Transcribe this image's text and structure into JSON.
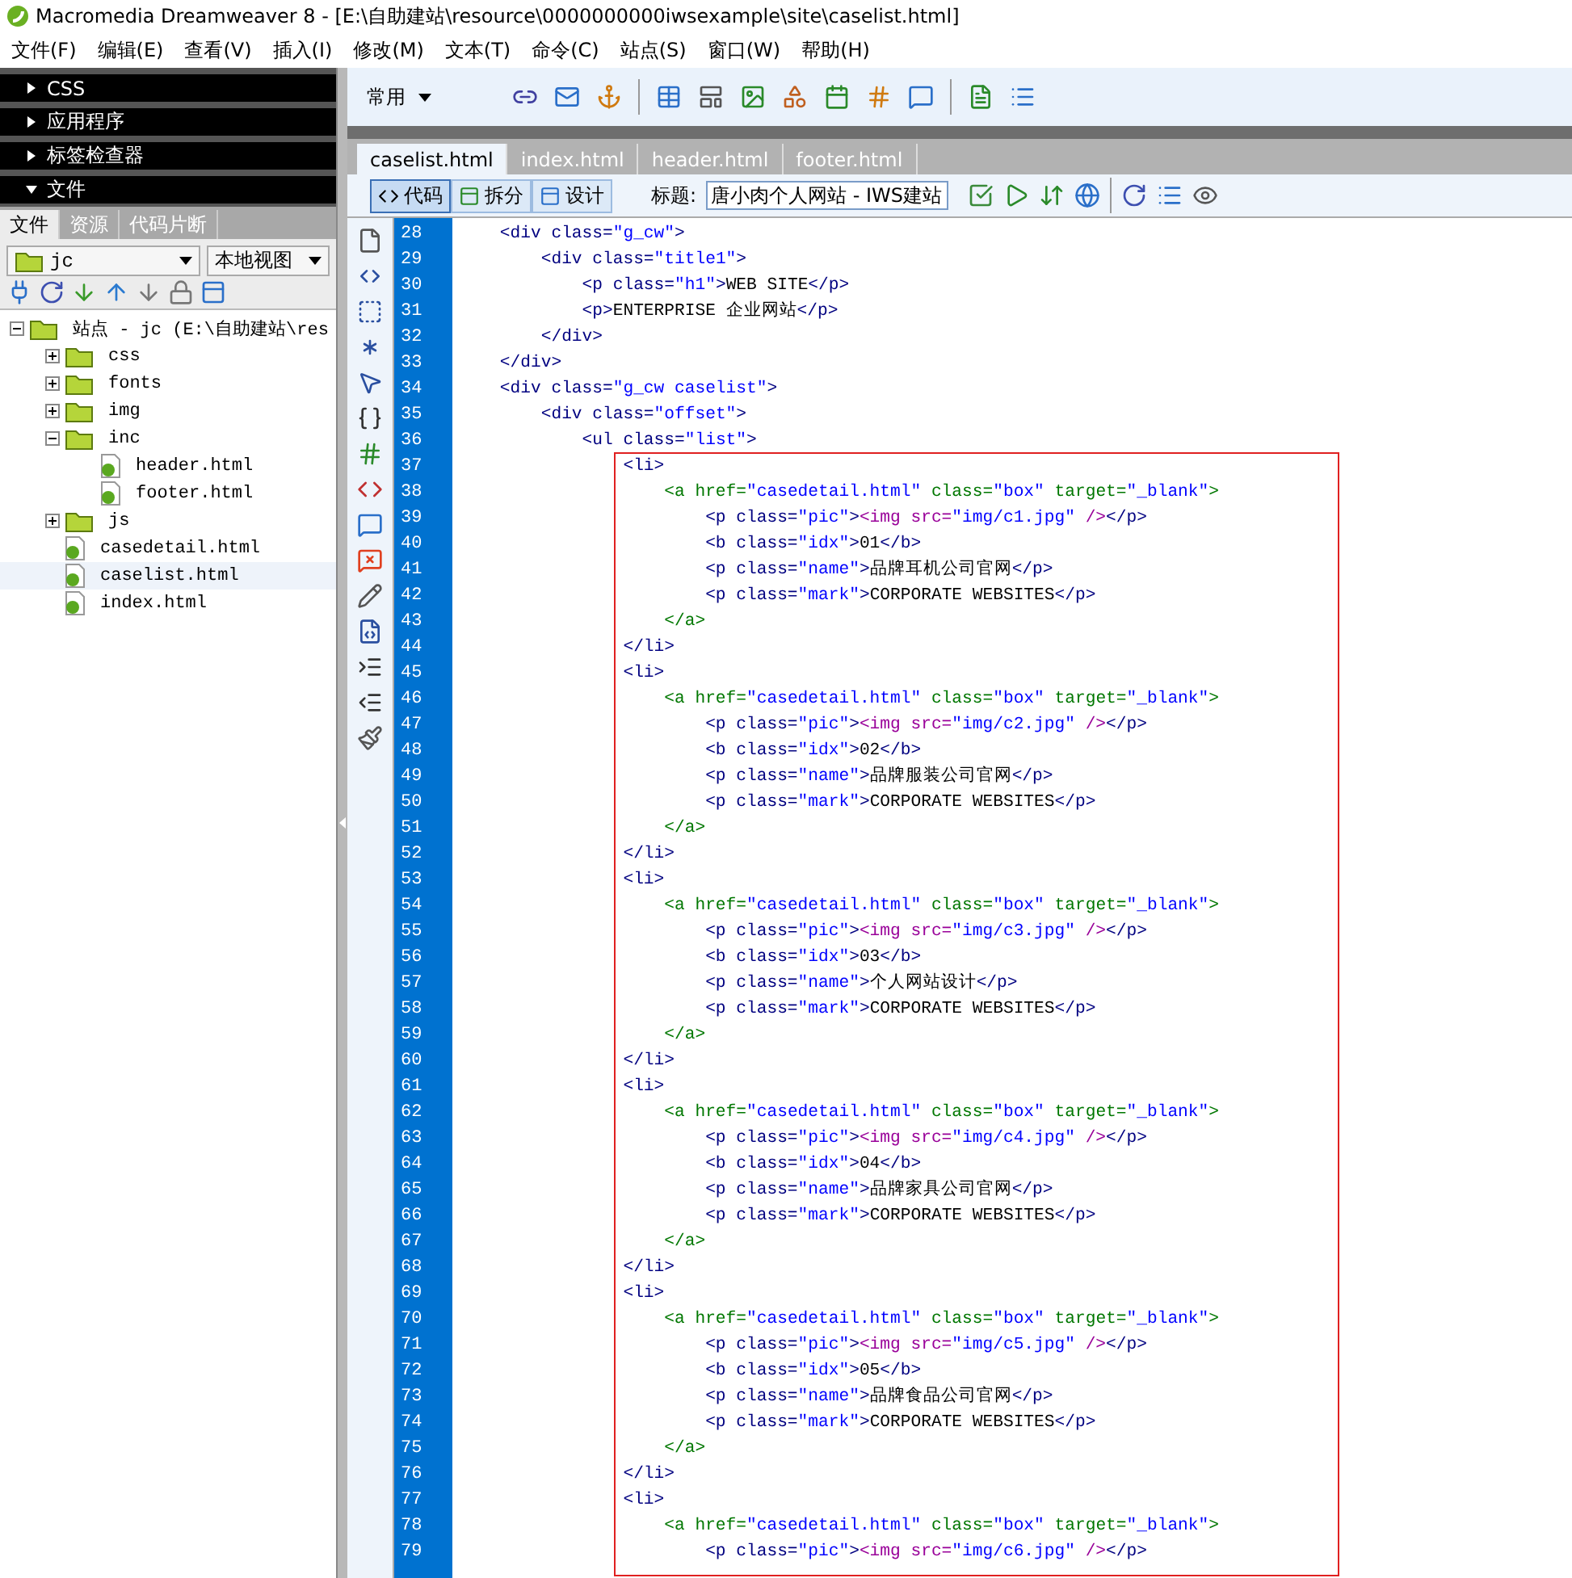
{
  "window": {
    "title": "Macromedia Dreamweaver 8 - [E:\\自助建站\\resource\\0000000000iwsexample\\site\\caselist.html]"
  },
  "menu": [
    "文件(F)",
    "编辑(E)",
    "查看(V)",
    "插入(I)",
    "修改(M)",
    "文本(T)",
    "命令(C)",
    "站点(S)",
    "窗口(W)",
    "帮助(H)"
  ],
  "panels": [
    {
      "title": "CSS",
      "expanded": false
    },
    {
      "title": "应用程序",
      "expanded": false
    },
    {
      "title": "标签检查器",
      "expanded": false
    },
    {
      "title": "文件",
      "expanded": true
    }
  ],
  "files_panel": {
    "tabs": [
      {
        "label": "文件",
        "selected": true
      },
      {
        "label": "资源",
        "selected": false
      },
      {
        "label": "代码片断",
        "selected": false
      }
    ],
    "site": "jc",
    "view": "本地视图",
    "tree": [
      {
        "label": "站点 - jc (E:\\自助建站\\res",
        "kind": "folder",
        "expanded": true,
        "selected": false,
        "children": [
          {
            "label": "css",
            "kind": "folder",
            "expanded": false,
            "selected": false
          },
          {
            "label": "fonts",
            "kind": "folder",
            "expanded": false,
            "selected": false
          },
          {
            "label": "img",
            "kind": "folder",
            "expanded": false,
            "selected": false
          },
          {
            "label": "inc",
            "kind": "folder",
            "expanded": true,
            "selected": false,
            "children": [
              {
                "label": "header.html",
                "kind": "file",
                "selected": false
              },
              {
                "label": "footer.html",
                "kind": "file",
                "selected": false
              }
            ]
          },
          {
            "label": "js",
            "kind": "folder",
            "expanded": false,
            "selected": false
          },
          {
            "label": "casedetail.html",
            "kind": "file",
            "selected": false
          },
          {
            "label": "caselist.html",
            "kind": "file",
            "selected": true
          },
          {
            "label": "index.html",
            "kind": "file",
            "selected": false
          }
        ]
      }
    ]
  },
  "insert_bar": {
    "category": "常用"
  },
  "document_tabs": [
    {
      "label": "caselist.html",
      "selected": true
    },
    {
      "label": "index.html",
      "selected": false
    },
    {
      "label": "header.html",
      "selected": false
    },
    {
      "label": "footer.html",
      "selected": false
    }
  ],
  "document_toolbar": {
    "view_buttons": [
      {
        "label": "代码",
        "selected": true
      },
      {
        "label": "拆分",
        "selected": false
      },
      {
        "label": "设计",
        "selected": false
      }
    ],
    "title_label": "标题:",
    "title_value": "唐小肉个人网站 - IWS建站"
  },
  "editor": {
    "lines": [
      {
        "number": "28",
        "segments": [
          {
            "kind": "tag",
            "text": "    <div class="
          },
          {
            "kind": "value",
            "text": "\"g_cw\""
          },
          {
            "kind": "tag",
            "text": ">"
          }
        ]
      },
      {
        "number": "29",
        "segments": [
          {
            "kind": "tag",
            "text": "        <div class="
          },
          {
            "kind": "value",
            "text": "\"title1\""
          },
          {
            "kind": "tag",
            "text": ">"
          }
        ]
      },
      {
        "number": "30",
        "segments": [
          {
            "kind": "tag",
            "text": "            <p class="
          },
          {
            "kind": "value",
            "text": "\"h1\""
          },
          {
            "kind": "tag",
            "text": ">"
          },
          {
            "kind": "text",
            "text": "WEB SITE"
          },
          {
            "kind": "tag",
            "text": "</p>"
          }
        ]
      },
      {
        "number": "31",
        "segments": [
          {
            "kind": "tag",
            "text": "            <p>"
          },
          {
            "kind": "text",
            "text": "ENTERPRISE 企业网站"
          },
          {
            "kind": "tag",
            "text": "</p>"
          }
        ]
      },
      {
        "number": "32",
        "segments": [
          {
            "kind": "tag",
            "text": "        </div>"
          }
        ]
      },
      {
        "number": "33",
        "segments": [
          {
            "kind": "tag",
            "text": "    </div>"
          }
        ]
      },
      {
        "number": "34",
        "segments": [
          {
            "kind": "tag",
            "text": "    <div class="
          },
          {
            "kind": "value",
            "text": "\"g_cw caselist\""
          },
          {
            "kind": "tag",
            "text": ">"
          }
        ]
      },
      {
        "number": "35",
        "segments": [
          {
            "kind": "tag",
            "text": "        <div class="
          },
          {
            "kind": "value",
            "text": "\"offset\""
          },
          {
            "kind": "tag",
            "text": ">"
          }
        ]
      },
      {
        "number": "36",
        "segments": [
          {
            "kind": "tag",
            "text": "            <ul class="
          },
          {
            "kind": "value",
            "text": "\"list\""
          },
          {
            "kind": "tag",
            "text": ">"
          }
        ]
      }
    ],
    "boxed_lines": [
      {
        "number": "37",
        "segments": [
          {
            "kind": "tag",
            "text": "                <li>"
          }
        ]
      },
      {
        "number": "38",
        "segments": [
          {
            "kind": "anchor",
            "text": "                    <a href="
          },
          {
            "kind": "value",
            "text": "\"casedetail.html\""
          },
          {
            "kind": "anchor",
            "text": " class="
          },
          {
            "kind": "value",
            "text": "\"box\""
          },
          {
            "kind": "anchor",
            "text": " target="
          },
          {
            "kind": "value",
            "text": "\"_blank\""
          },
          {
            "kind": "anchor",
            "text": ">"
          }
        ]
      },
      {
        "number": "39",
        "segments": [
          {
            "kind": "tag",
            "text": "                        <p class="
          },
          {
            "kind": "value",
            "text": "\"pic\""
          },
          {
            "kind": "tag",
            "text": ">"
          },
          {
            "kind": "image",
            "text": "<img src="
          },
          {
            "kind": "value",
            "text": "\"img/c1.jpg\""
          },
          {
            "kind": "image",
            "text": " />"
          },
          {
            "kind": "tag",
            "text": "</p>"
          }
        ]
      },
      {
        "number": "40",
        "segments": [
          {
            "kind": "tag",
            "text": "                        <b class="
          },
          {
            "kind": "value",
            "text": "\"idx\""
          },
          {
            "kind": "tag",
            "text": ">"
          },
          {
            "kind": "text",
            "text": "01"
          },
          {
            "kind": "tag",
            "text": "</b>"
          }
        ]
      },
      {
        "number": "41",
        "segments": [
          {
            "kind": "tag",
            "text": "                        <p class="
          },
          {
            "kind": "value",
            "text": "\"name\""
          },
          {
            "kind": "tag",
            "text": ">"
          },
          {
            "kind": "text",
            "text": "品牌耳机公司官网"
          },
          {
            "kind": "tag",
            "text": "</p>"
          }
        ]
      },
      {
        "number": "42",
        "segments": [
          {
            "kind": "tag",
            "text": "                        <p class="
          },
          {
            "kind": "value",
            "text": "\"mark\""
          },
          {
            "kind": "tag",
            "text": ">"
          },
          {
            "kind": "text",
            "text": "CORPORATE WEBSITES"
          },
          {
            "kind": "tag",
            "text": "</p>"
          }
        ]
      },
      {
        "number": "43",
        "segments": [
          {
            "kind": "anchor",
            "text": "                    </a>"
          }
        ]
      },
      {
        "number": "44",
        "segments": [
          {
            "kind": "tag",
            "text": "                </li>"
          }
        ]
      },
      {
        "number": "45",
        "segments": [
          {
            "kind": "tag",
            "text": "                <li>"
          }
        ]
      },
      {
        "number": "46",
        "segments": [
          {
            "kind": "anchor",
            "text": "                    <a href="
          },
          {
            "kind": "value",
            "text": "\"casedetail.html\""
          },
          {
            "kind": "anchor",
            "text": " class="
          },
          {
            "kind": "value",
            "text": "\"box\""
          },
          {
            "kind": "anchor",
            "text": " target="
          },
          {
            "kind": "value",
            "text": "\"_blank\""
          },
          {
            "kind": "anchor",
            "text": ">"
          }
        ]
      },
      {
        "number": "47",
        "segments": [
          {
            "kind": "tag",
            "text": "                        <p class="
          },
          {
            "kind": "value",
            "text": "\"pic\""
          },
          {
            "kind": "tag",
            "text": ">"
          },
          {
            "kind": "image",
            "text": "<img src="
          },
          {
            "kind": "value",
            "text": "\"img/c2.jpg\""
          },
          {
            "kind": "image",
            "text": " />"
          },
          {
            "kind": "tag",
            "text": "</p>"
          }
        ]
      },
      {
        "number": "48",
        "segments": [
          {
            "kind": "tag",
            "text": "                        <b class="
          },
          {
            "kind": "value",
            "text": "\"idx\""
          },
          {
            "kind": "tag",
            "text": ">"
          },
          {
            "kind": "text",
            "text": "02"
          },
          {
            "kind": "tag",
            "text": "</b>"
          }
        ]
      },
      {
        "number": "49",
        "segments": [
          {
            "kind": "tag",
            "text": "                        <p class="
          },
          {
            "kind": "value",
            "text": "\"name\""
          },
          {
            "kind": "tag",
            "text": ">"
          },
          {
            "kind": "text",
            "text": "品牌服装公司官网"
          },
          {
            "kind": "tag",
            "text": "</p>"
          }
        ]
      },
      {
        "number": "50",
        "segments": [
          {
            "kind": "tag",
            "text": "                        <p class="
          },
          {
            "kind": "value",
            "text": "\"mark\""
          },
          {
            "kind": "tag",
            "text": ">"
          },
          {
            "kind": "text",
            "text": "CORPORATE WEBSITES"
          },
          {
            "kind": "tag",
            "text": "</p>"
          }
        ]
      },
      {
        "number": "51",
        "segments": [
          {
            "kind": "anchor",
            "text": "                    </a>"
          }
        ]
      },
      {
        "number": "52",
        "segments": [
          {
            "kind": "tag",
            "text": "                </li>"
          }
        ]
      },
      {
        "number": "53",
        "segments": [
          {
            "kind": "tag",
            "text": "                <li>"
          }
        ]
      },
      {
        "number": "54",
        "segments": [
          {
            "kind": "anchor",
            "text": "                    <a href="
          },
          {
            "kind": "value",
            "text": "\"casedetail.html\""
          },
          {
            "kind": "anchor",
            "text": " class="
          },
          {
            "kind": "value",
            "text": "\"box\""
          },
          {
            "kind": "anchor",
            "text": " target="
          },
          {
            "kind": "value",
            "text": "\"_blank\""
          },
          {
            "kind": "anchor",
            "text": ">"
          }
        ]
      },
      {
        "number": "55",
        "segments": [
          {
            "kind": "tag",
            "text": "                        <p class="
          },
          {
            "kind": "value",
            "text": "\"pic\""
          },
          {
            "kind": "tag",
            "text": ">"
          },
          {
            "kind": "image",
            "text": "<img src="
          },
          {
            "kind": "value",
            "text": "\"img/c3.jpg\""
          },
          {
            "kind": "image",
            "text": " />"
          },
          {
            "kind": "tag",
            "text": "</p>"
          }
        ]
      },
      {
        "number": "56",
        "segments": [
          {
            "kind": "tag",
            "text": "                        <b class="
          },
          {
            "kind": "value",
            "text": "\"idx\""
          },
          {
            "kind": "tag",
            "text": ">"
          },
          {
            "kind": "text",
            "text": "03"
          },
          {
            "kind": "tag",
            "text": "</b>"
          }
        ]
      },
      {
        "number": "57",
        "segments": [
          {
            "kind": "tag",
            "text": "                        <p class="
          },
          {
            "kind": "value",
            "text": "\"name\""
          },
          {
            "kind": "tag",
            "text": ">"
          },
          {
            "kind": "text",
            "text": "个人网站设计"
          },
          {
            "kind": "tag",
            "text": "</p>"
          }
        ]
      },
      {
        "number": "58",
        "segments": [
          {
            "kind": "tag",
            "text": "                        <p class="
          },
          {
            "kind": "value",
            "text": "\"mark\""
          },
          {
            "kind": "tag",
            "text": ">"
          },
          {
            "kind": "text",
            "text": "CORPORATE WEBSITES"
          },
          {
            "kind": "tag",
            "text": "</p>"
          }
        ]
      },
      {
        "number": "59",
        "segments": [
          {
            "kind": "anchor",
            "text": "                    </a>"
          }
        ]
      },
      {
        "number": "60",
        "segments": [
          {
            "kind": "tag",
            "text": "                </li>"
          }
        ]
      },
      {
        "number": "61",
        "segments": [
          {
            "kind": "tag",
            "text": "                <li>"
          }
        ]
      },
      {
        "number": "62",
        "segments": [
          {
            "kind": "anchor",
            "text": "                    <a href="
          },
          {
            "kind": "value",
            "text": "\"casedetail.html\""
          },
          {
            "kind": "anchor",
            "text": " class="
          },
          {
            "kind": "value",
            "text": "\"box\""
          },
          {
            "kind": "anchor",
            "text": " target="
          },
          {
            "kind": "value",
            "text": "\"_blank\""
          },
          {
            "kind": "anchor",
            "text": ">"
          }
        ]
      },
      {
        "number": "63",
        "segments": [
          {
            "kind": "tag",
            "text": "                        <p class="
          },
          {
            "kind": "value",
            "text": "\"pic\""
          },
          {
            "kind": "tag",
            "text": ">"
          },
          {
            "kind": "image",
            "text": "<img src="
          },
          {
            "kind": "value",
            "text": "\"img/c4.jpg\""
          },
          {
            "kind": "image",
            "text": " />"
          },
          {
            "kind": "tag",
            "text": "</p>"
          }
        ]
      },
      {
        "number": "64",
        "segments": [
          {
            "kind": "tag",
            "text": "                        <b class="
          },
          {
            "kind": "value",
            "text": "\"idx\""
          },
          {
            "kind": "tag",
            "text": ">"
          },
          {
            "kind": "text",
            "text": "04"
          },
          {
            "kind": "tag",
            "text": "</b>"
          }
        ]
      },
      {
        "number": "65",
        "segments": [
          {
            "kind": "tag",
            "text": "                        <p class="
          },
          {
            "kind": "value",
            "text": "\"name\""
          },
          {
            "kind": "tag",
            "text": ">"
          },
          {
            "kind": "text",
            "text": "品牌家具公司官网"
          },
          {
            "kind": "tag",
            "text": "</p>"
          }
        ]
      },
      {
        "number": "66",
        "segments": [
          {
            "kind": "tag",
            "text": "                        <p class="
          },
          {
            "kind": "value",
            "text": "\"mark\""
          },
          {
            "kind": "tag",
            "text": ">"
          },
          {
            "kind": "text",
            "text": "CORPORATE WEBSITES"
          },
          {
            "kind": "tag",
            "text": "</p>"
          }
        ]
      },
      {
        "number": "67",
        "segments": [
          {
            "kind": "anchor",
            "text": "                    </a>"
          }
        ]
      },
      {
        "number": "68",
        "segments": [
          {
            "kind": "tag",
            "text": "                </li>"
          }
        ]
      },
      {
        "number": "69",
        "segments": [
          {
            "kind": "tag",
            "text": "                <li>"
          }
        ]
      },
      {
        "number": "70",
        "segments": [
          {
            "kind": "anchor",
            "text": "                    <a href="
          },
          {
            "kind": "value",
            "text": "\"casedetail.html\""
          },
          {
            "kind": "anchor",
            "text": " class="
          },
          {
            "kind": "value",
            "text": "\"box\""
          },
          {
            "kind": "anchor",
            "text": " target="
          },
          {
            "kind": "value",
            "text": "\"_blank\""
          },
          {
            "kind": "anchor",
            "text": ">"
          }
        ]
      },
      {
        "number": "71",
        "segments": [
          {
            "kind": "tag",
            "text": "                        <p class="
          },
          {
            "kind": "value",
            "text": "\"pic\""
          },
          {
            "kind": "tag",
            "text": ">"
          },
          {
            "kind": "image",
            "text": "<img src="
          },
          {
            "kind": "value",
            "text": "\"img/c5.jpg\""
          },
          {
            "kind": "image",
            "text": " />"
          },
          {
            "kind": "tag",
            "text": "</p>"
          }
        ]
      },
      {
        "number": "72",
        "segments": [
          {
            "kind": "tag",
            "text": "                        <b class="
          },
          {
            "kind": "value",
            "text": "\"idx\""
          },
          {
            "kind": "tag",
            "text": ">"
          },
          {
            "kind": "text",
            "text": "05"
          },
          {
            "kind": "tag",
            "text": "</b>"
          }
        ]
      },
      {
        "number": "73",
        "segments": [
          {
            "kind": "tag",
            "text": "                        <p class="
          },
          {
            "kind": "value",
            "text": "\"name\""
          },
          {
            "kind": "tag",
            "text": ">"
          },
          {
            "kind": "text",
            "text": "品牌食品公司官网"
          },
          {
            "kind": "tag",
            "text": "</p>"
          }
        ]
      },
      {
        "number": "74",
        "segments": [
          {
            "kind": "tag",
            "text": "                        <p class="
          },
          {
            "kind": "value",
            "text": "\"mark\""
          },
          {
            "kind": "tag",
            "text": ">"
          },
          {
            "kind": "text",
            "text": "CORPORATE WEBSITES"
          },
          {
            "kind": "tag",
            "text": "</p>"
          }
        ]
      },
      {
        "number": "75",
        "segments": [
          {
            "kind": "anchor",
            "text": "                    </a>"
          }
        ]
      },
      {
        "number": "76",
        "segments": [
          {
            "kind": "tag",
            "text": "                </li>"
          }
        ]
      },
      {
        "number": "77",
        "segments": [
          {
            "kind": "tag",
            "text": "                <li>"
          }
        ]
      },
      {
        "number": "78",
        "segments": [
          {
            "kind": "anchor",
            "text": "                    <a href="
          },
          {
            "kind": "value",
            "text": "\"casedetail.html\""
          },
          {
            "kind": "anchor",
            "text": " class="
          },
          {
            "kind": "value",
            "text": "\"box\""
          },
          {
            "kind": "anchor",
            "text": " target="
          },
          {
            "kind": "value",
            "text": "\"_blank\""
          },
          {
            "kind": "anchor",
            "text": ">"
          }
        ]
      },
      {
        "number": "79",
        "segments": [
          {
            "kind": "tag",
            "text": "                        <p class="
          },
          {
            "kind": "value",
            "text": "\"pic\""
          },
          {
            "kind": "tag",
            "text": ">"
          },
          {
            "kind": "image",
            "text": "<img src="
          },
          {
            "kind": "value",
            "text": "\"img/c6.jpg\""
          },
          {
            "kind": "image",
            "text": " />"
          },
          {
            "kind": "tag",
            "text": "</p>"
          }
        ]
      }
    ]
  }
}
